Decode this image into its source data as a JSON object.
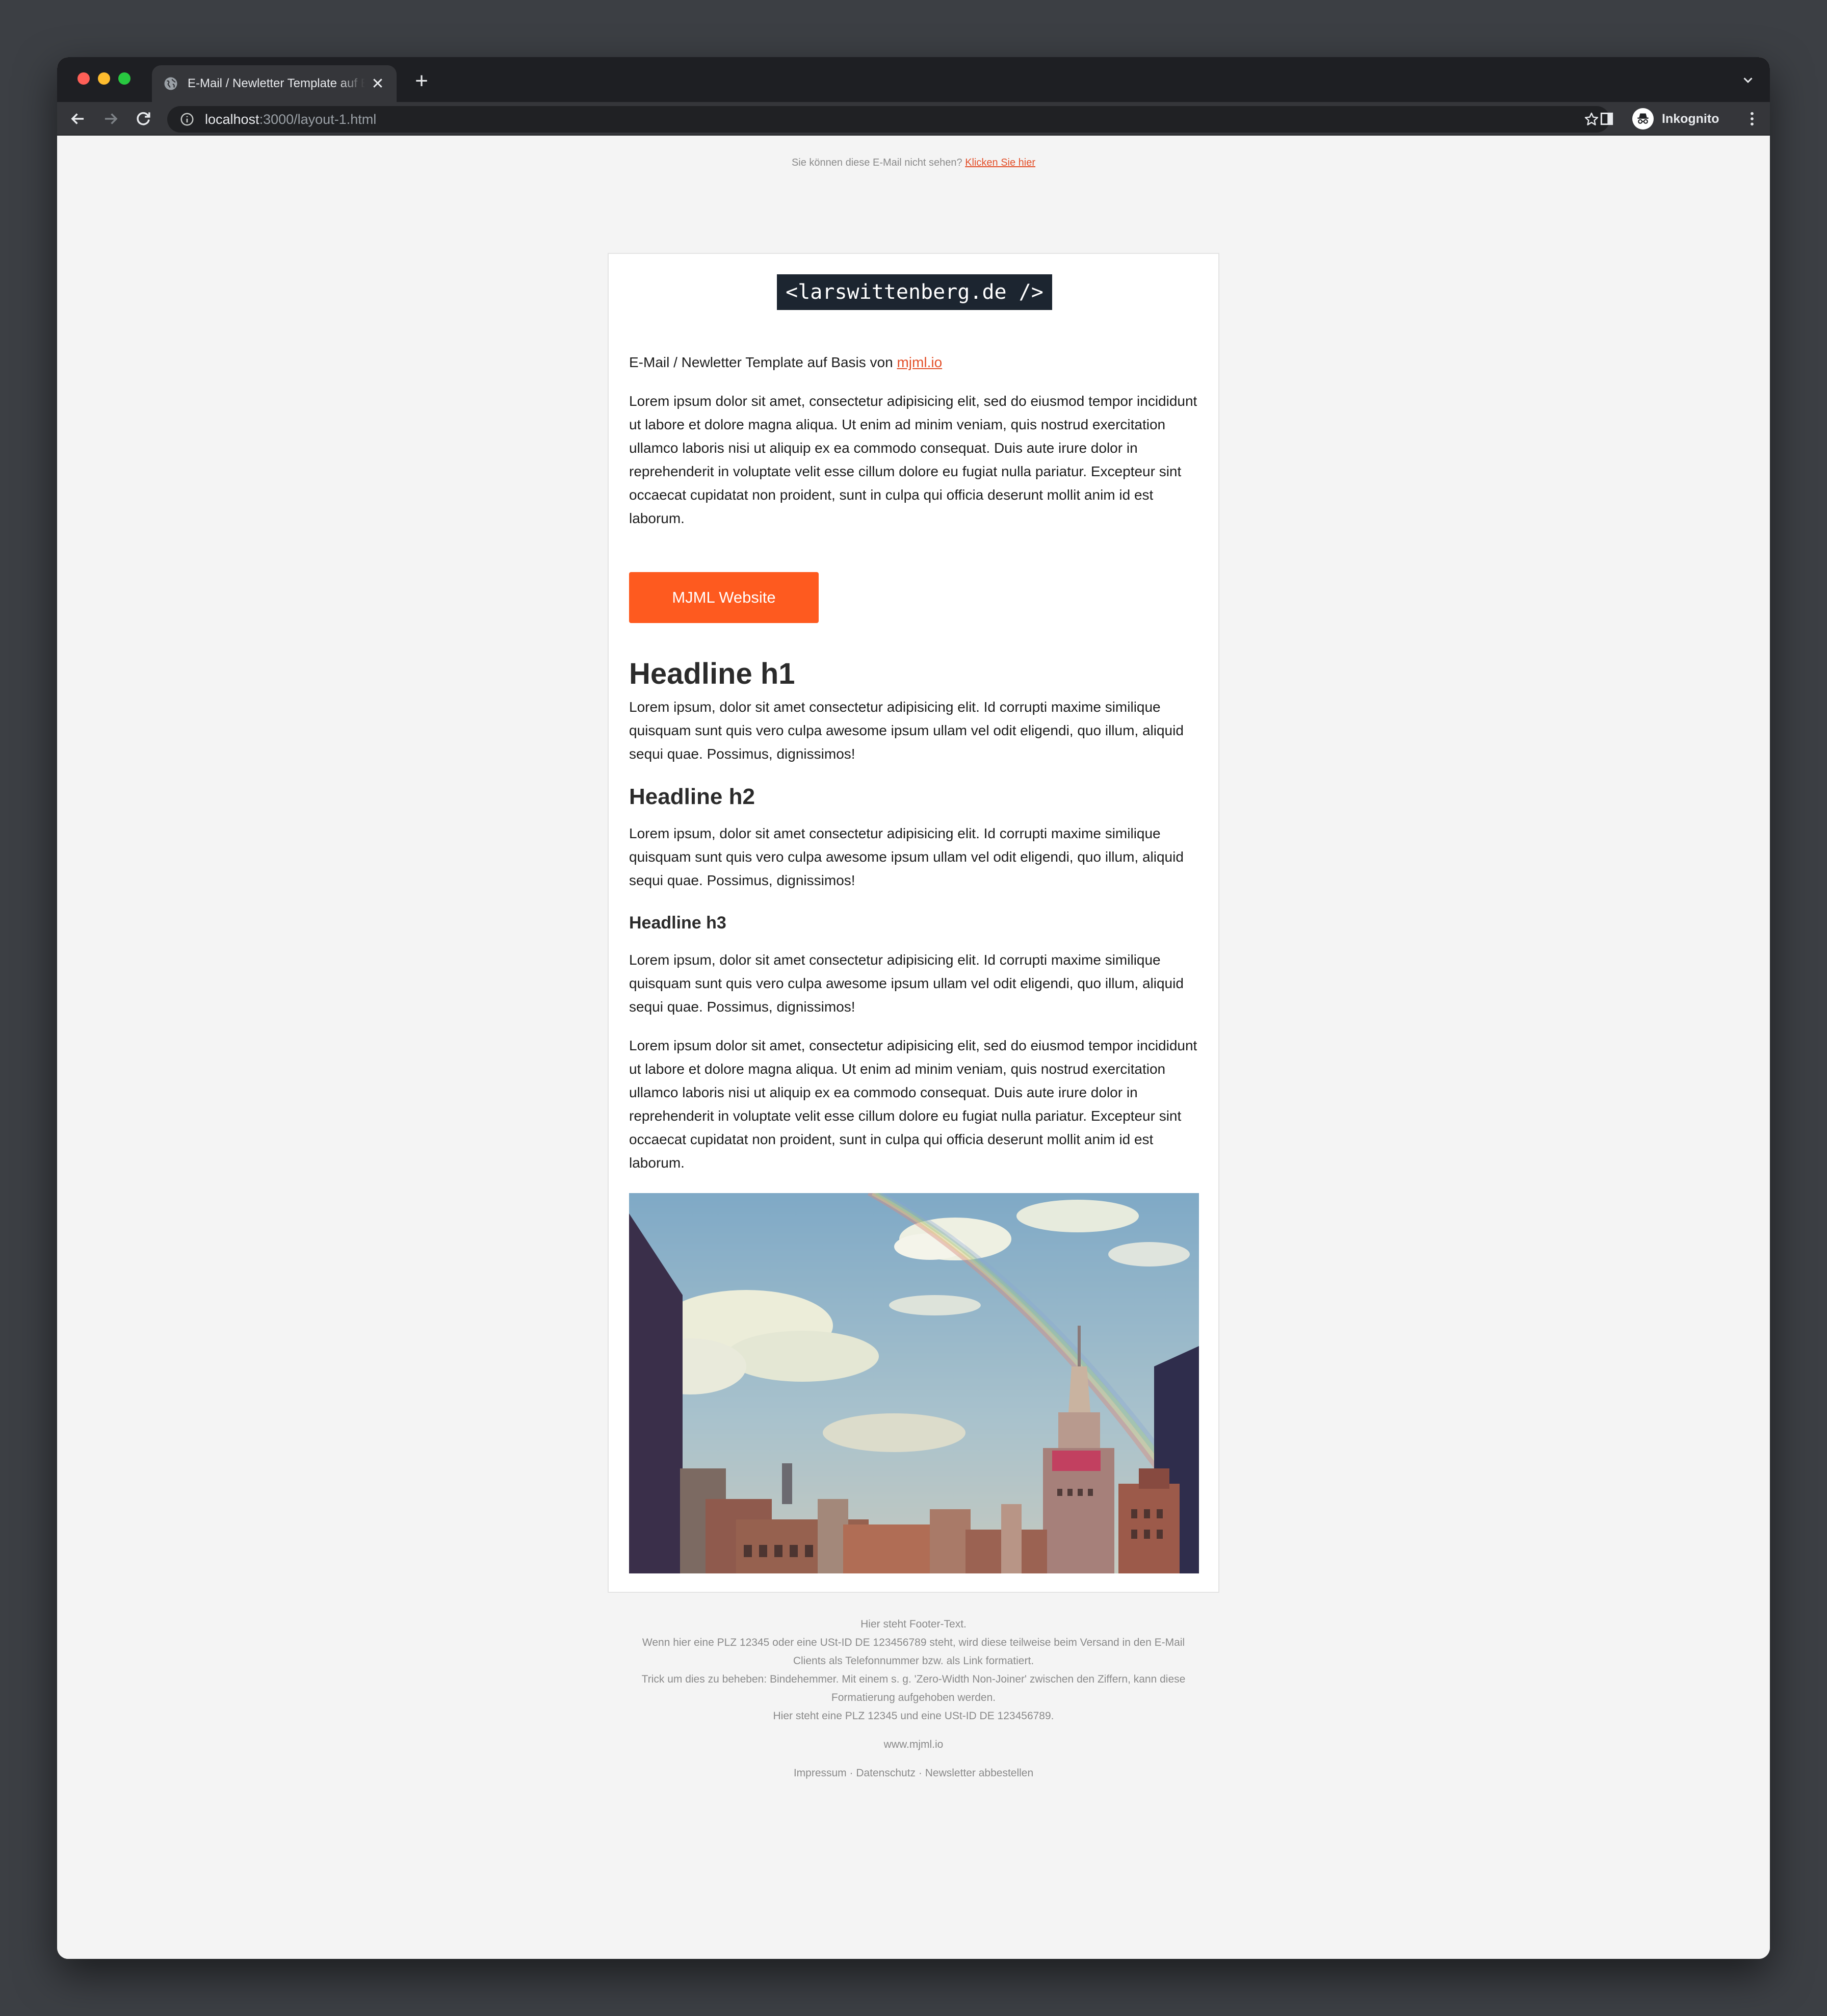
{
  "browser": {
    "tab_title": "E-Mail / Newletter Template auf Basis von mjml.io",
    "url_host": "localhost",
    "url_path": ":3000/layout-1.html",
    "incognito_label": "Inkognito"
  },
  "email": {
    "preheader_text": "Sie können diese E-Mail nicht sehen?",
    "preheader_link": "Klicken Sie hier",
    "logo_text": "<larswittenberg.de />",
    "intro_text": "E-Mail / Newletter Template auf Basis von",
    "intro_link": "mjml.io",
    "paragraph_long": "Lorem ipsum dolor sit amet, consectetur adipisicing elit, sed do eiusmod tempor incididunt ut labore et dolore magna aliqua. Ut enim ad minim veniam, quis nostrud exercitation ullamco laboris nisi ut aliquip ex ea commodo consequat. Duis aute irure dolor in reprehenderit in voluptate velit esse cillum dolore eu fugiat nulla pariatur. Excepteur sint occaecat cupidatat non proident, sunt in culpa qui officia deserunt mollit anim id est laborum.",
    "button_label": "MJML Website",
    "h1": "Headline h1",
    "h2": "Headline h2",
    "h3": "Headline h3",
    "paragraph_short": "Lorem ipsum, dolor sit amet consectetur adipisicing elit. Id corrupti maxime similique quisquam sunt quis vero culpa awesome ipsum ullam vel odit eligendi, quo illum, aliquid sequi quae. Possimus, dignissimos!",
    "image_subject": "New York skyline with rainbow"
  },
  "footer": {
    "line1": "Hier steht Footer-Text.",
    "line2": "Wenn hier eine PLZ 12345 oder eine USt-ID DE 123456789 steht, wird diese teilweise beim Versand in den E-Mail Clients als Telefonnummer bzw. als Link formatiert.",
    "line3": "Trick um dies zu beheben: Bindehemmer. Mit einem s. g. 'Zero-Width Non-Joiner' zwischen den Ziffern, kann diese Formatierung aufgehoben werden.",
    "line4": "Hier steht eine PLZ 12345 und eine USt-ID DE 123456789.",
    "site": "www.mjml.io",
    "links": "Impressum · Datenschutz · Newsletter abbestellen"
  },
  "colors": {
    "accent": "#fe5a1f",
    "link": "#e3502a",
    "logo_bg": "#1c2530"
  },
  "icons": [
    "globe-icon",
    "close-icon",
    "plus-icon",
    "chevron-down-icon",
    "back-arrow-icon",
    "forward-arrow-icon",
    "reload-icon",
    "info-icon",
    "star-icon",
    "side-panel-icon",
    "incognito-icon",
    "more-vert-icon"
  ]
}
